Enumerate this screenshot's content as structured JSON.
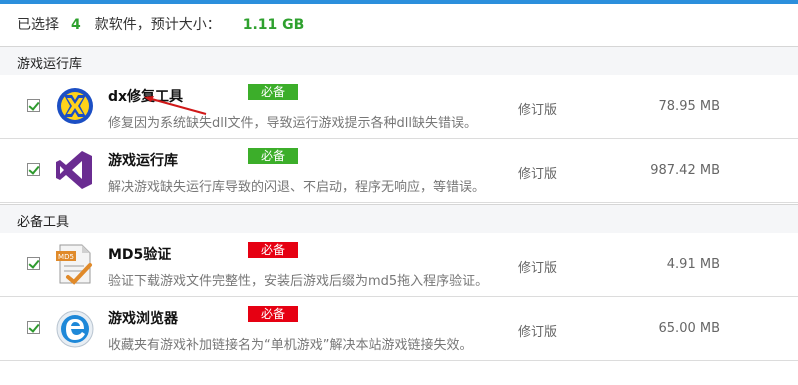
{
  "summary": {
    "prefix": "已选择",
    "count": "4",
    "middle": "款软件，预计大小：",
    "total_size": "1.11 GB"
  },
  "sections": [
    {
      "title": "游戏运行库",
      "items": [
        {
          "name": "dx修复工具",
          "badge": "必备",
          "badge_color": "#3cae2a",
          "desc": "修复因为系统缺失dll文件，导致运行游戏提示各种dll缺失错误。",
          "version": "修订版",
          "size": "78.95 MB",
          "checked": true,
          "icon": "dx-repair-icon"
        },
        {
          "name": "游戏运行库",
          "badge": "必备",
          "badge_color": "#3cae2a",
          "desc": "解决游戏缺失运行库导致的闪退、不启动，程序无响应，等错误。",
          "version": "修订版",
          "size": "987.42 MB",
          "checked": true,
          "icon": "visual-studio-icon"
        }
      ]
    },
    {
      "title": "必备工具",
      "items": [
        {
          "name": "MD5验证",
          "badge": "必备",
          "badge_color": "#e60012",
          "desc": "验证下载游戏文件完整性，安装后游戏后缀为md5拖入程序验证。",
          "version": "修订版",
          "size": "4.91 MB",
          "checked": true,
          "icon": "md5-verify-icon"
        },
        {
          "name": "游戏浏览器",
          "badge": "必备",
          "badge_color": "#e60012",
          "desc": "收藏夹有游戏补加链接名为“单机游戏”解决本站游戏链接失效。",
          "version": "修订版",
          "size": "65.00 MB",
          "checked": true,
          "icon": "browser-icon"
        }
      ]
    }
  ]
}
